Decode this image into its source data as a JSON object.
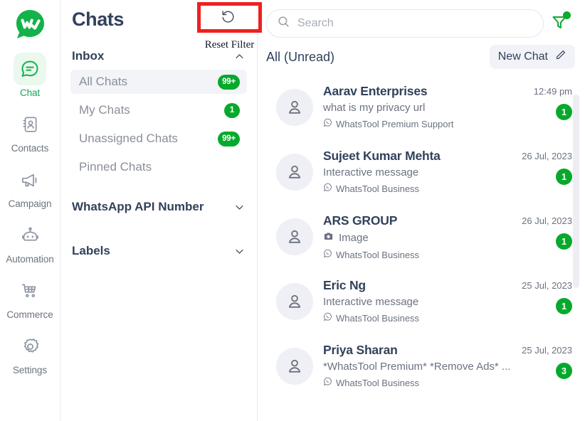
{
  "brand": {
    "logo_icon": "whatstool-logo-icon",
    "accent_green": "#07a92c",
    "accent_green_light": "#eaf8ee",
    "text_dark": "#32415c",
    "annotation_red": "#ee2020"
  },
  "rail": {
    "items": [
      {
        "label": "Chat",
        "icon": "chat-bubble-icon",
        "active": true
      },
      {
        "label": "Contacts",
        "icon": "contacts-book-icon",
        "active": false
      },
      {
        "label": "Campaign",
        "icon": "megaphone-icon",
        "active": false
      },
      {
        "label": "Automation",
        "icon": "robot-icon",
        "active": false
      },
      {
        "label": "Commerce",
        "icon": "shopping-cart-icon",
        "active": false
      },
      {
        "label": "Settings",
        "icon": "gear-icon",
        "active": false
      }
    ]
  },
  "inbox_panel": {
    "title": "Chats",
    "reset_filter": {
      "icon": "reset-rotate-ccw-icon",
      "annotation_label": "Reset Filter"
    },
    "sections": [
      {
        "title": "Inbox",
        "chevron": "chevron-up-icon",
        "expanded": true
      },
      {
        "title": "WhatsApp API Number",
        "chevron": "chevron-down-icon",
        "expanded": false
      },
      {
        "title": "Labels",
        "chevron": "chevron-down-icon",
        "expanded": false
      }
    ],
    "inbox_items": [
      {
        "label": "All Chats",
        "badge": "99+",
        "selected": true
      },
      {
        "label": "My Chats",
        "badge": "1",
        "selected": false
      },
      {
        "label": "Unassigned Chats",
        "badge": "99+",
        "selected": false
      },
      {
        "label": "Pinned Chats",
        "badge": "",
        "selected": false
      }
    ]
  },
  "chat_panel": {
    "search": {
      "icon": "search-icon",
      "placeholder": "Search",
      "value": ""
    },
    "filter": {
      "icon": "filter-funnel-icon",
      "has_active_dot": true
    },
    "list_header": {
      "title": "All (Unread)",
      "new_chat_label": "New Chat",
      "new_chat_icon": "pencil-edit-icon"
    },
    "scrollbar": {
      "name": "chat-list-scrollbar"
    },
    "chats": [
      {
        "avatar_icon": "person-avatar-icon",
        "name": "Aarav Enterprises",
        "preview": "what is my privacy url",
        "preview_icon": "",
        "channel_icon": "whatsapp-icon",
        "channel": "WhatsTool Premium Support",
        "time": "12:49 pm",
        "unread": "1"
      },
      {
        "avatar_icon": "person-avatar-icon",
        "name": "Sujeet Kumar Mehta",
        "preview": "Interactive message",
        "preview_icon": "",
        "channel_icon": "whatsapp-icon",
        "channel": "WhatsTool Business",
        "time": "26 Jul, 2023",
        "unread": "1"
      },
      {
        "avatar_icon": "person-avatar-icon",
        "name": "ARS GROUP",
        "preview": "Image",
        "preview_icon": "camera-icon",
        "channel_icon": "whatsapp-icon",
        "channel": "WhatsTool Business",
        "time": "26 Jul, 2023",
        "unread": "1"
      },
      {
        "avatar_icon": "person-avatar-icon",
        "name": "Eric Ng",
        "preview": "Interactive message",
        "preview_icon": "",
        "channel_icon": "whatsapp-icon",
        "channel": "WhatsTool Business",
        "time": "25 Jul, 2023",
        "unread": "1"
      },
      {
        "avatar_icon": "person-avatar-icon",
        "name": "Priya Sharan",
        "preview": "*WhatsTool Premium* *Remove Ads* ...",
        "preview_icon": "",
        "channel_icon": "whatsapp-icon",
        "channel": "WhatsTool Business",
        "time": "25 Jul, 2023",
        "unread": "3"
      }
    ]
  }
}
